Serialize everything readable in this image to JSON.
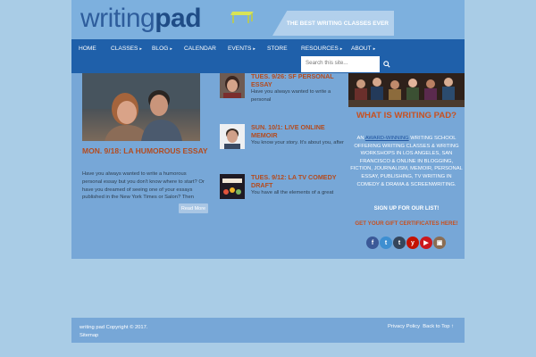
{
  "header": {
    "logo_word1": "writing",
    "logo_word2": "pad",
    "tagline": "THE BEST WRITING CLASSES EVER"
  },
  "nav": {
    "items": [
      {
        "label": "HOME",
        "has_menu": false
      },
      {
        "label": "CLASSES",
        "has_menu": true
      },
      {
        "label": "BLOG",
        "has_menu": true
      },
      {
        "label": "CALENDAR",
        "has_menu": false
      },
      {
        "label": "EVENTS",
        "has_menu": true
      },
      {
        "label": "STORE",
        "has_menu": false
      },
      {
        "label": "RESOURCES",
        "has_menu": true
      },
      {
        "label": "ABOUT",
        "has_menu": true
      }
    ],
    "search_placeholder": "Search this site..."
  },
  "feature": {
    "title": "MON. 9/18: LA HUMOROUS ESSAY",
    "excerpt": "Have you always wanted to write a humorous personal essay but you don't know where to start? Or have you dreamed of seeing one of your essays published in the New York Times or Salon? Then",
    "read_more": "Read More"
  },
  "posts": [
    {
      "title": "TUES. 9/26: SF PERSONAL ESSAY",
      "excerpt": "Have you always wanted to write a personal"
    },
    {
      "title": "SUN. 10/1: LIVE ONLINE MEMOIR",
      "excerpt": "You know your story. It's about you, after"
    },
    {
      "title": "TUES. 9/12: LA TV COMEDY DRAFT",
      "excerpt": "You have all the elements of a great"
    }
  ],
  "sidebar": {
    "title": "WHAT IS WRITING PAD?",
    "text_before": "AN ",
    "highlight": "AWARD-WINNING",
    "text_after": " WRITING SCHOOL OFFERING WRITING CLASSES & WRITING WORKSHOPS IN LOS ANGELES, SAN FRANCISCO & ONLINE IN BLOGGING, FICTION, JOURNALISM, MEMOIR, PERSONAL ESSAY, PUBLISHING, TV WRITING IN COMEDY & DRAMA & SCREENWRITING.",
    "signup": "SIGN UP FOR OUR LIST!",
    "gift": "GET YOUR  GIFT CERTIFICATES HERE!",
    "social": [
      {
        "icon": "facebook-icon",
        "glyph": "f",
        "color": "#3b5998"
      },
      {
        "icon": "tumblr-icon",
        "glyph": "t",
        "color": "#3e8fd1"
      },
      {
        "icon": "tumblr-dark-icon",
        "glyph": "t",
        "color": "#35465c"
      },
      {
        "icon": "yelp-icon",
        "glyph": "y",
        "color": "#c41200"
      },
      {
        "icon": "youtube-icon",
        "glyph": "▶",
        "color": "#cc181e"
      },
      {
        "icon": "instagram-icon",
        "glyph": "▣",
        "color": "#8a6d54"
      }
    ]
  },
  "footer": {
    "copyright": "writing pad Copyright © 2017.",
    "sitemap": "Sitemap",
    "privacy": "Privacy Policy",
    "back_to_top": "Back to Top ↑"
  }
}
